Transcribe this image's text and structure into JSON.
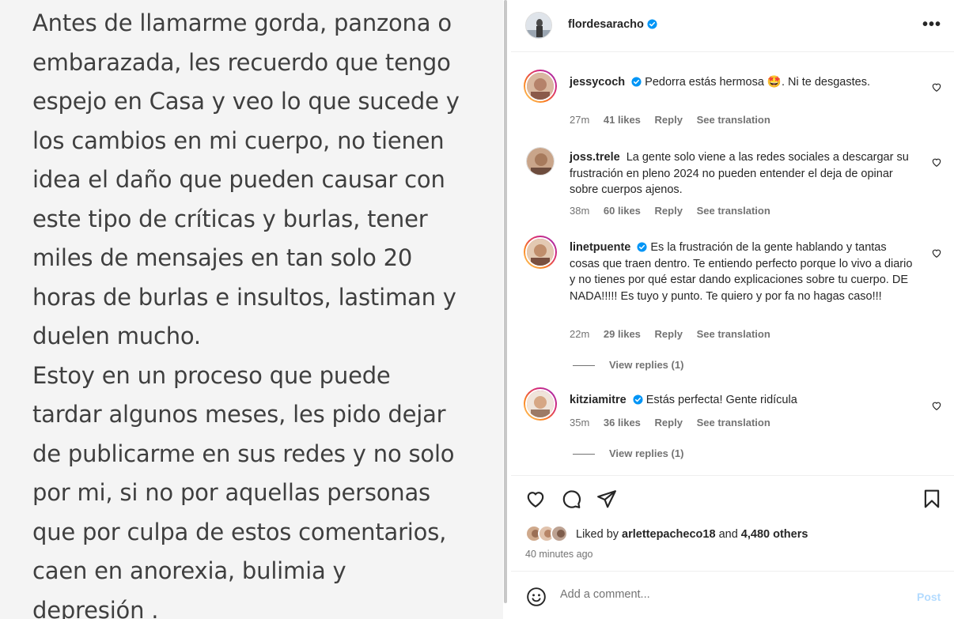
{
  "post_image": {
    "lines": [
      "Antes de llamarme gorda, panzona o",
      "embarazada, les recuerdo que tengo",
      "espejo en Casa y veo lo que sucede y",
      "los cambios en mi cuerpo, no tienen",
      "idea el daño que pueden causar con",
      "este tipo de críticas y burlas, tener",
      "miles de mensajes en tan solo 20",
      "horas de burlas e insultos, lastiman y",
      "duelen mucho.",
      "Estoy en un proceso que puede",
      "tardar algunos meses, les pido dejar",
      "de publicarme en sus redes y no solo",
      "por mi, si no por aquellas personas",
      "que por culpa de estos comentarios,",
      "caen en anorexia, bulimia y",
      "depresión ."
    ]
  },
  "header": {
    "username": "flordesaracho",
    "more_label": "•••"
  },
  "comments": [
    {
      "username": "jessycoch",
      "text": "Pedorra estás hermosa 🤩. Ni te desgastes.",
      "time": "27m",
      "likes": "41 likes",
      "reply": "Reply",
      "translate": "See translation"
    },
    {
      "username": "joss.trele",
      "text": "La gente solo viene a las redes sociales a descargar su frustración en pleno 2024 no pueden entender el deja de opinar sobre cuerpos ajenos.",
      "time": "38m",
      "likes": "60 likes",
      "reply": "Reply",
      "translate": "See translation"
    },
    {
      "username": "linetpuente",
      "text": "Es la frustración de la gente hablando y tantas cosas que traen dentro. Te entiendo perfecto porque lo vivo a diario y no tienes por qué estar dando explicaciones sobre tu cuerpo. DE NADA!!!!! Es tuyo y punto. Te quiero y por fa no hagas caso!!!",
      "time": "22m",
      "likes": "29 likes",
      "reply": "Reply",
      "translate": "See translation",
      "view_replies": "View replies (1)"
    },
    {
      "username": "kitziamitre",
      "text": "Estás perfecta! Gente ridícula",
      "time": "35m",
      "likes": "36 likes",
      "reply": "Reply",
      "translate": "See translation",
      "view_replies": "View replies (1)"
    }
  ],
  "likes": {
    "prefix": "Liked by",
    "user": "arlettepacheco18",
    "joiner": "and",
    "others": "4,480 others"
  },
  "time_ago": "40 minutes ago",
  "add_comment": {
    "placeholder": "Add a comment...",
    "post_label": "Post"
  },
  "colors": {
    "verified": "#0095f6",
    "post_disabled": "#b3dbff",
    "muted_text": "#737373"
  }
}
